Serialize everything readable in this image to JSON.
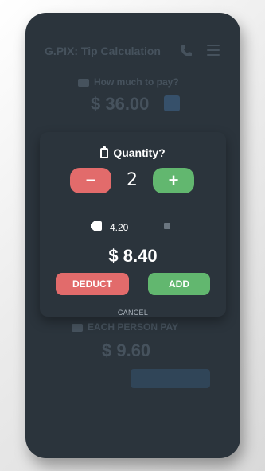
{
  "app": {
    "title": "G.PIX: Tip Calculation",
    "bill_label": "How much to pay?",
    "bill_amount": "$ 36.00",
    "each_label": "EACH PERSON PAY",
    "each_amount": "$ 9.60"
  },
  "dialog": {
    "title": "Quantity?",
    "minus_label": "−",
    "plus_label": "+",
    "quantity": "2",
    "price_value": "4.20",
    "total": "$ 8.40",
    "deduct_label": "DEDUCT",
    "add_label": "ADD",
    "cancel_label": "CANCEL"
  },
  "colors": {
    "background": "#2b343c",
    "deduct": "#e26b6b",
    "add": "#62b76f"
  },
  "icons": {
    "title": "clipboard-icon",
    "price": "tag-icon"
  }
}
